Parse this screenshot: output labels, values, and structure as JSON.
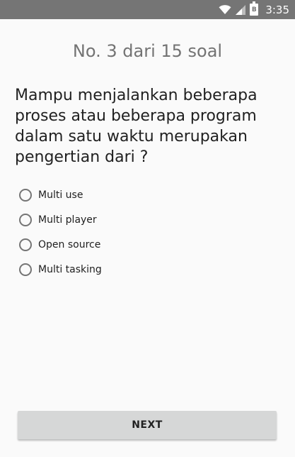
{
  "status_bar": {
    "time": "3:35",
    "battery_level_label": "B",
    "icons": [
      "wifi-icon",
      "cell-signal-icon",
      "battery-icon"
    ],
    "background_color": "#757575"
  },
  "quiz": {
    "counter": "No. 3 dari 15 soal",
    "question": "Mampu menjalankan beberapa proses atau beberapa program dalam satu waktu merupakan pengertian dari ?",
    "options": [
      {
        "label": "Multi use"
      },
      {
        "label": "Multi player"
      },
      {
        "label": "Open source"
      },
      {
        "label": "Multi tasking"
      }
    ],
    "next_label": "NEXT"
  }
}
